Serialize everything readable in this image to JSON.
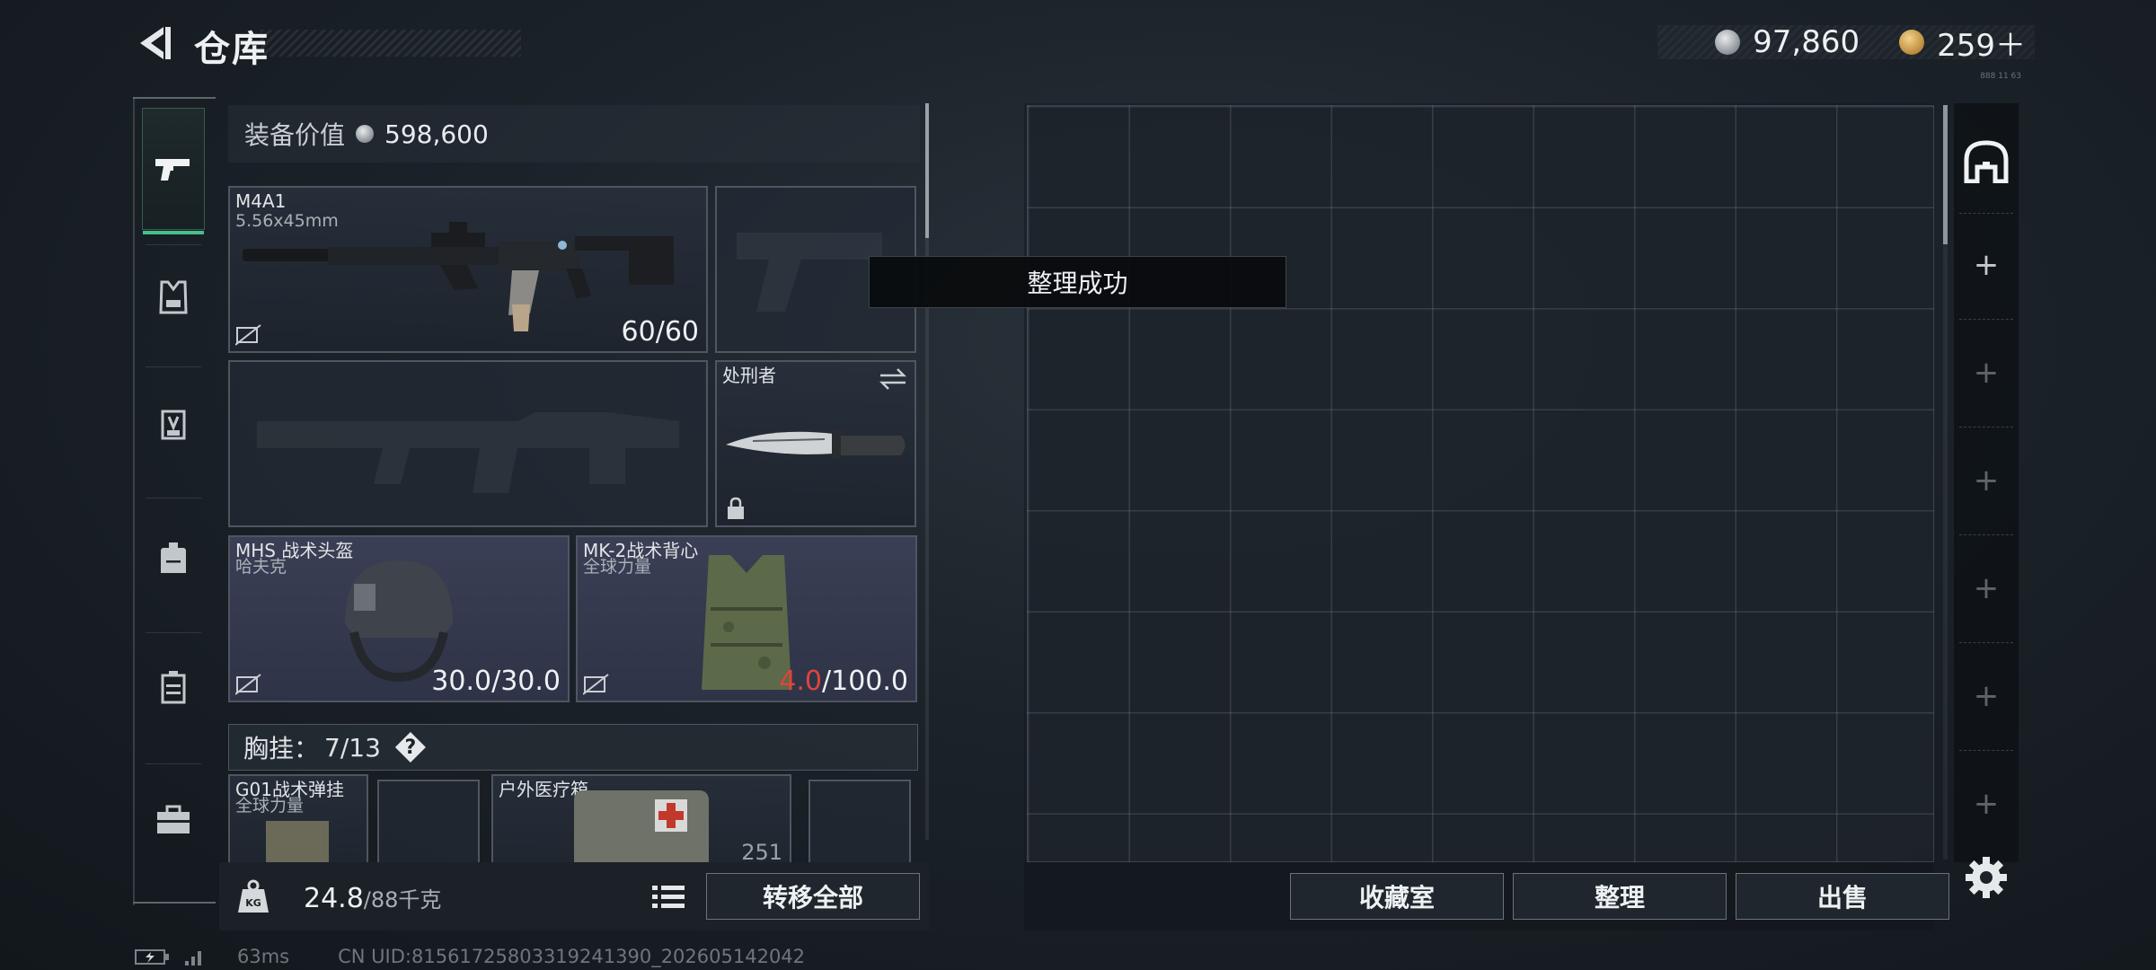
{
  "header": {
    "title": "仓库",
    "currencies": [
      {
        "icon": "silver-coin-icon",
        "value": "97,860"
      },
      {
        "icon": "gold-coin-icon",
        "value": "259＋"
      }
    ],
    "tiny_text": "888 11 63"
  },
  "sidebar": {
    "items": [
      {
        "name": "weapons",
        "icon": "pistol-icon",
        "active": true
      },
      {
        "name": "armor",
        "icon": "vest-icon",
        "active": false
      },
      {
        "name": "chest-rig",
        "icon": "rig-icon",
        "active": false
      },
      {
        "name": "backpack",
        "icon": "backpack-icon",
        "active": false
      },
      {
        "name": "cases",
        "icon": "case-icon",
        "active": false
      },
      {
        "name": "toolbox",
        "icon": "toolbox-icon",
        "active": false
      }
    ]
  },
  "equipment": {
    "value_label": "装备价值",
    "value": "598,600",
    "primary_weapon": {
      "name": "M4A1",
      "caliber": "5.56x45mm",
      "ammo": "60/60"
    },
    "melee": {
      "name": "处刑者"
    },
    "helmet": {
      "name": "MHS 战术头盔",
      "brand": "哈夫克",
      "durability_current": "30.0",
      "durability_max": "/30.0"
    },
    "vest": {
      "name": "MK-2战术背心",
      "brand": "全球力量",
      "durability_current": "4.0",
      "durability_max": "/100.0"
    },
    "chest_rig": {
      "label": "胸挂：",
      "count": "7/13",
      "help": "?"
    },
    "rig_slots": [
      {
        "name": "G01战术弹挂",
        "brand": "全球力量"
      },
      {
        "name": "户外医疗箱",
        "value": "251"
      }
    ],
    "weight_current": "24.8",
    "weight_max": "/88千克",
    "kg_label": "KG",
    "transfer_all": "转移全部"
  },
  "storage": {
    "buttons": {
      "collection": "收藏室",
      "sort": "整理",
      "sell": "出售"
    }
  },
  "toast": "整理成功",
  "status": {
    "ping": "63ms",
    "uid": "CN UID:81561725803319241390_202605142042"
  },
  "colors": {
    "accent_green": "#46c08a",
    "durability_low": "#e0443a",
    "armor_slot_bg": "#3a3f55"
  }
}
